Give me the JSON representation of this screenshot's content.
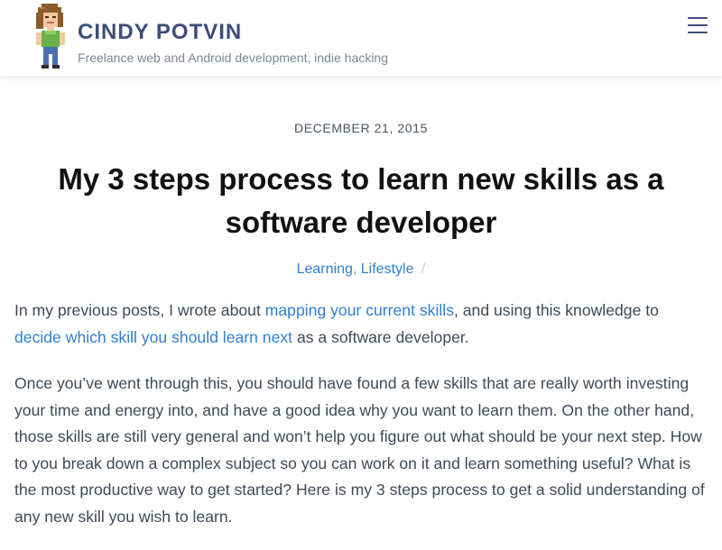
{
  "header": {
    "site_title": "CINDY POTVIN",
    "tagline": "Freelance web and Android development, indie hacking",
    "avatar_icon": "pixel-art-avatar-icon",
    "menu_icon": "hamburger-menu-icon"
  },
  "post": {
    "date": "DECEMBER 21, 2015",
    "title": "My 3 steps process to learn new skills as a software developer",
    "categories": [
      "Learning",
      "Lifestyle"
    ],
    "category_separator": "/",
    "paragraph1": {
      "text_before": "In my previous posts, I wrote about ",
      "link1": "mapping your current skills",
      "text_middle": ", and using this knowledge to ",
      "link2": "decide which skill you should learn next",
      "text_after": " as a software developer."
    },
    "paragraph2": "Once you’ve went through this, you should have found a few skills that are really worth investing your time and energy into, and have a good idea why you want to learn them. On the other hand, those skills are still very general and won’t help you figure out what should be your next step. How to you break down a complex subject so you can work on it and learn something useful? What is the most productive way to get started? Here is my 3 steps process to get a solid understanding of any new skill you wish to learn."
  },
  "colors": {
    "brand": "#3d4c7a",
    "link": "#2f7fd1",
    "body_text": "#3e4a57"
  }
}
